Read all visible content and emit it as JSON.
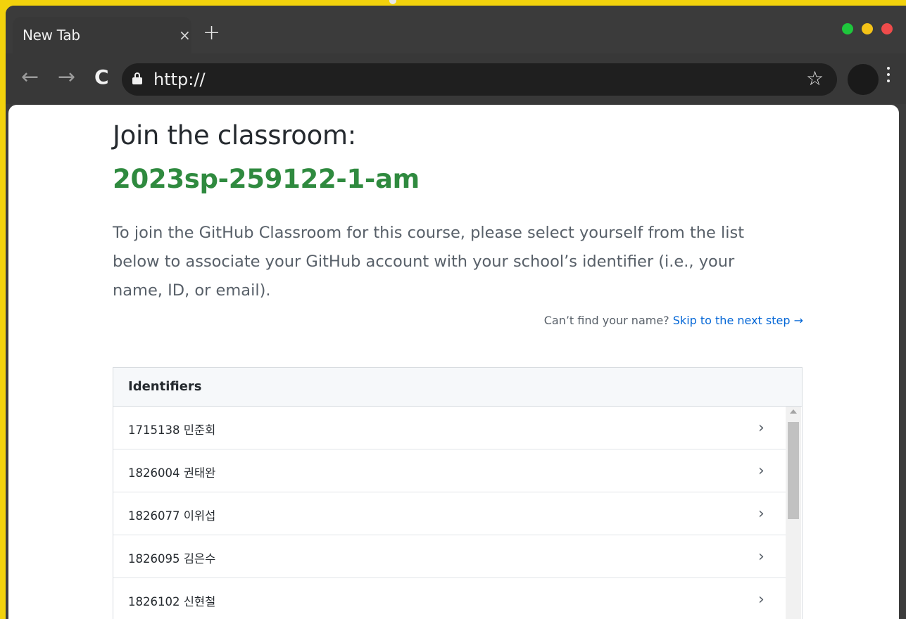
{
  "browser": {
    "tab_title": "New Tab",
    "tab_close": "×",
    "new_tab": "+",
    "url": "http://",
    "back_icon": "arrow-left",
    "forward_icon": "arrow-right",
    "reload_icon": "reload",
    "bookmark_icon": "star",
    "window_colors": {
      "green": "#1ec73c",
      "yellow": "#f4c317",
      "red": "#ef4b4b"
    }
  },
  "page": {
    "heading": "Join the classroom:",
    "classroom_name": "2023sp-259122-1-am",
    "intro": "To join the GitHub Classroom for this course, please select yourself from the list below to associate your GitHub account with your school’s identifier (i.e., your name, ID, or email).",
    "skip_prompt": "Can’t find your name?",
    "skip_link": "Skip to the next step →",
    "table_header": "Identifiers",
    "identifiers": [
      "1715138  민준회",
      "1826004  권태완",
      "1826077  이위섭",
      "1826095  김은수",
      "1826102  신현철"
    ],
    "accent_color": "#28a745",
    "link_color": "#0366d6"
  }
}
